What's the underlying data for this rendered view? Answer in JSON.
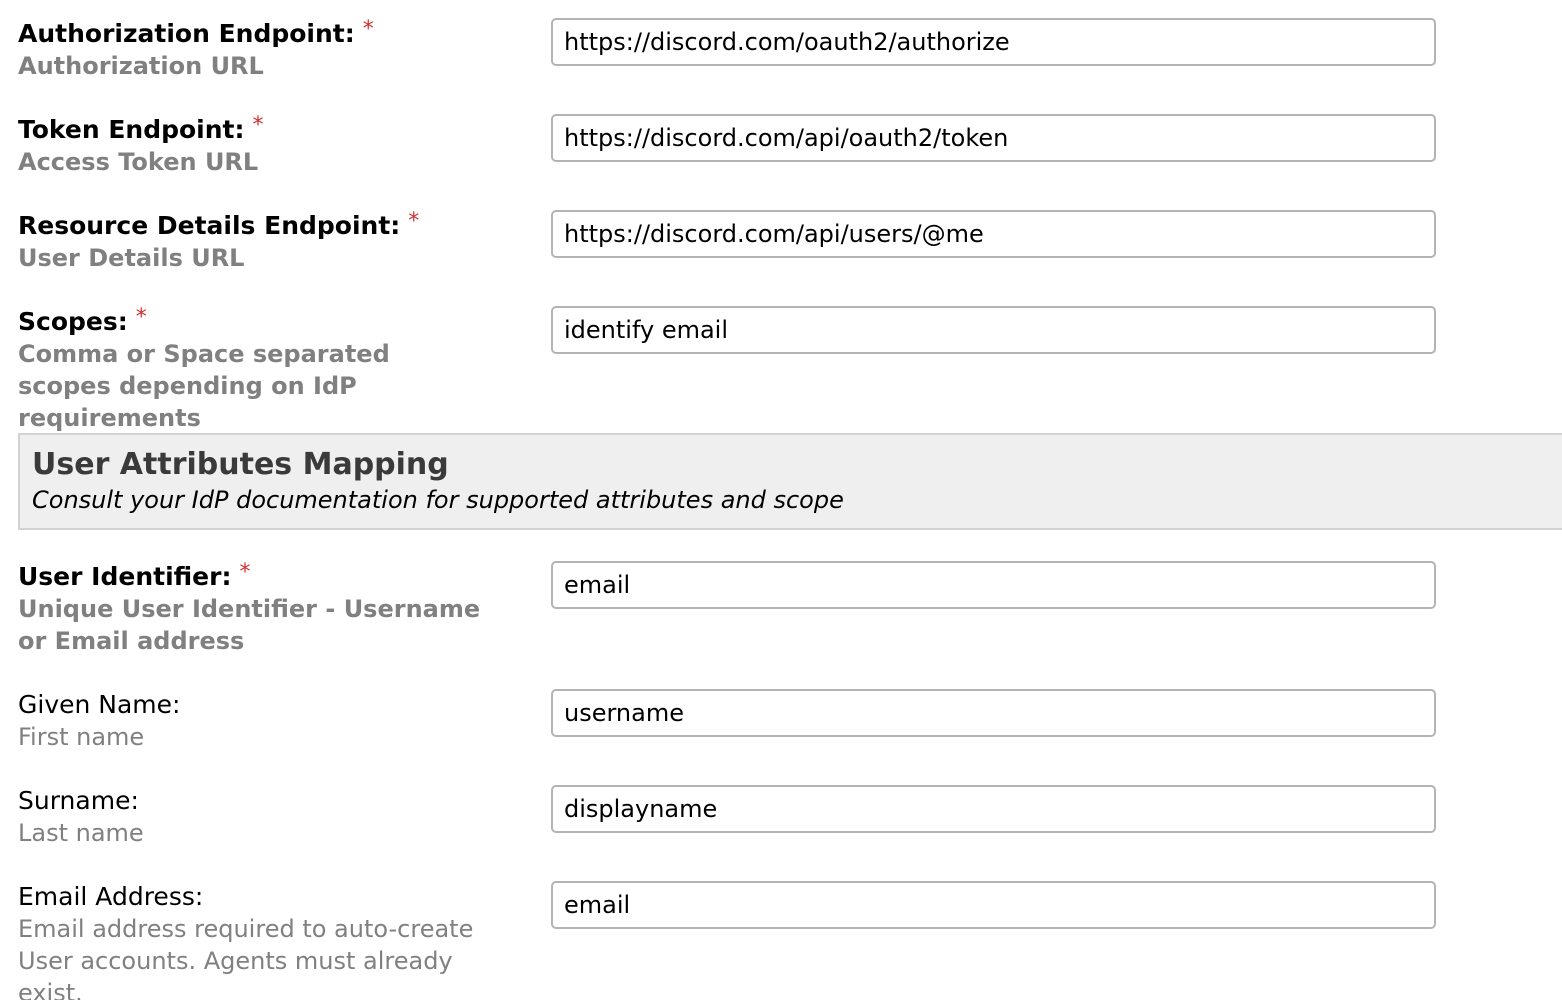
{
  "required_marker": "*",
  "fields": {
    "authorization_endpoint": {
      "label": "Authorization Endpoint:",
      "hint": "Authorization URL",
      "value": "https://discord.com/oauth2/authorize",
      "required": true
    },
    "token_endpoint": {
      "label": "Token Endpoint:",
      "hint": "Access Token URL",
      "value": "https://discord.com/api/oauth2/token",
      "required": true
    },
    "resource_details_endpoint": {
      "label": "Resource Details Endpoint:",
      "hint": "User Details URL",
      "value": "https://discord.com/api/users/@me",
      "required": true
    },
    "scopes": {
      "label": "Scopes:",
      "hint": "Comma or Space separated scopes depending on IdP requirements",
      "value": "identify email",
      "required": true
    },
    "user_identifier": {
      "label": "User Identifier:",
      "hint": "Unique User Identifier - Username or Email address",
      "value": "email",
      "required": true
    },
    "given_name": {
      "label": "Given Name:",
      "hint": "First name",
      "value": "username",
      "required": false
    },
    "surname": {
      "label": "Surname:",
      "hint": "Last name",
      "value": "displayname",
      "required": false
    },
    "email_address": {
      "label": "Email Address:",
      "hint": "Email address required to auto-create User accounts. Agents must already exist.",
      "value": "email",
      "required": false
    }
  },
  "section": {
    "title": "User Attributes Mapping",
    "subtitle": "Consult your IdP documentation for supported attributes and scope"
  },
  "colors": {
    "required_marker": "#d32f2f",
    "hint_text": "#808080",
    "input_border": "#b4b4b4",
    "section_background": "#efefef",
    "section_border": "#d2d2d2"
  }
}
